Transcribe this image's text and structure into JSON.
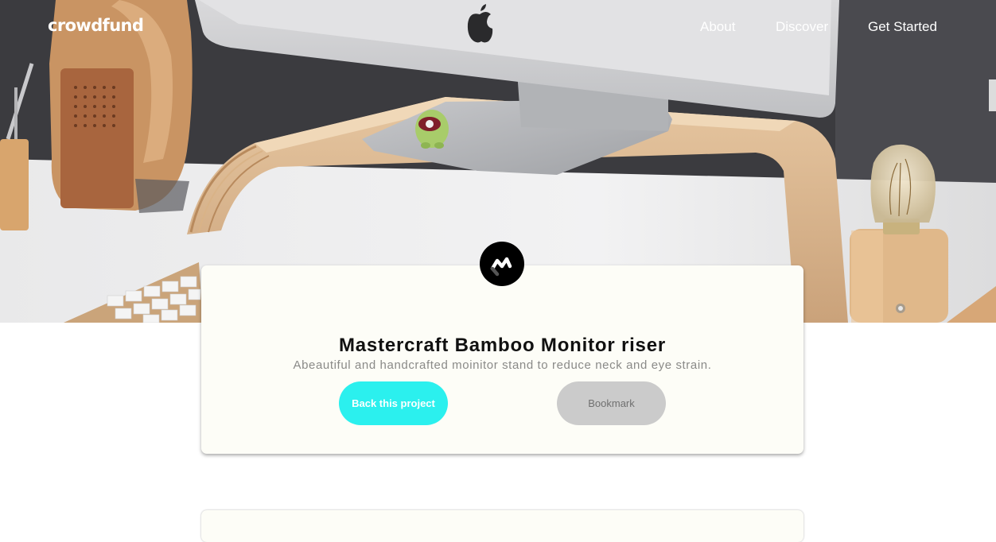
{
  "nav": {
    "logo": "crowdfund",
    "links": [
      {
        "label": "About"
      },
      {
        "label": "Discover"
      },
      {
        "label": "Get Started"
      }
    ]
  },
  "project": {
    "title": "Mastercraft Bamboo Monitor riser",
    "description": "Abeautiful and handcrafted moinitor stand to reduce neck and eye strain.",
    "back_label": "Back this project",
    "bookmark_label": "Bookmark"
  },
  "colors": {
    "accent": "#2bf0ee",
    "bookmark_bg": "#cbcbcb",
    "card_bg": "#fdfdf7"
  },
  "icons": {
    "brand": "mastercraft-logo-icon",
    "monitor_brand": "apple-logo-icon"
  }
}
